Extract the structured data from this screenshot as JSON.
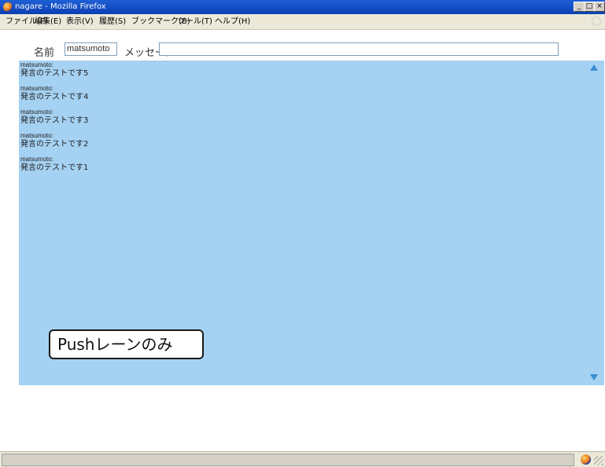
{
  "window": {
    "title": "nagare - Mozilla Firefox"
  },
  "menu": [
    "ファイル(F)",
    "編集(E)",
    "表示(V)",
    "履歴(S)",
    "ブックマーク(B)",
    "ツール(T)",
    "ヘルプ(H)"
  ],
  "form": {
    "name_label": "名前",
    "name_value": "matsumoto",
    "message_label": "メッセージ",
    "message_value": ""
  },
  "messages": [
    {
      "user": "matsumoto:",
      "text": "発言のテストです5"
    },
    {
      "user": "matsumoto:",
      "text": "発言のテストです4"
    },
    {
      "user": "matsumoto:",
      "text": "発言のテストです3"
    },
    {
      "user": "matsumoto:",
      "text": "発言のテストです2"
    },
    {
      "user": "matsumoto:",
      "text": "発言のテストです1"
    }
  ],
  "annotation": "Pushレーンのみ",
  "status": {
    "text": ""
  },
  "colors": {
    "message_area": "#a5d1f2",
    "titlebar": "#1f5fd6"
  }
}
